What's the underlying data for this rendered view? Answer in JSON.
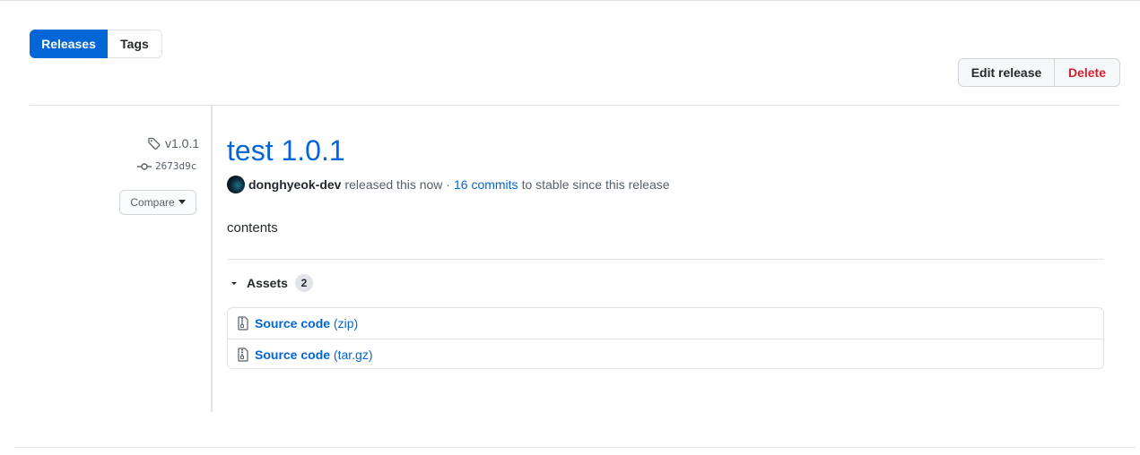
{
  "subnav": {
    "releases_label": "Releases",
    "tags_label": "Tags"
  },
  "actions": {
    "edit_label": "Edit release",
    "delete_label": "Delete"
  },
  "sidebar": {
    "tag": "v1.0.1",
    "commit": "2673d9c",
    "compare_label": "Compare"
  },
  "release": {
    "title": "test 1.0.1",
    "author": "donghyeok-dev",
    "released_text": "released this now ·",
    "commits_link": "16 commits",
    "commits_suffix": "to stable since this release",
    "body": "contents"
  },
  "assets": {
    "label": "Assets",
    "count": "2",
    "items": [
      {
        "name": "Source code",
        "ext": "(zip)"
      },
      {
        "name": "Source code",
        "ext": "(tar.gz)"
      }
    ]
  },
  "colors": {
    "accent": "#0366d6",
    "danger": "#cb2431",
    "border": "#e1e4e8"
  }
}
